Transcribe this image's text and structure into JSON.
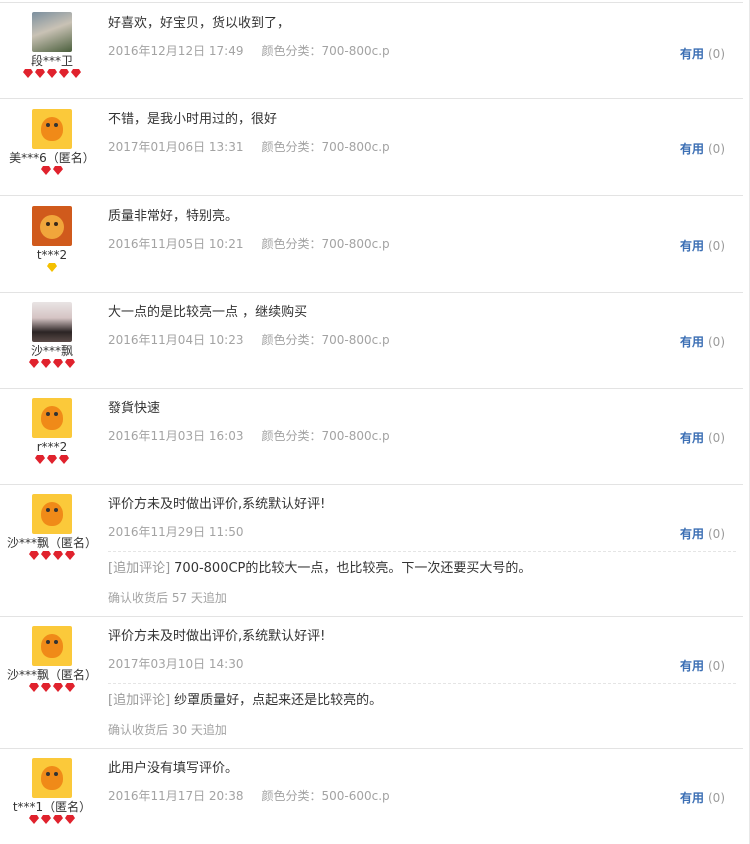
{
  "useful_label": "有用",
  "reviews": [
    {
      "avatar": "photo-avatar-plant",
      "username": "段***卫",
      "rank": {
        "color": "red",
        "count": 5
      },
      "content": "好喜欢，好宝贝，货以收到了，",
      "date": "2016年12月12日 17:49",
      "sku": "颜色分类：700-800c.p",
      "useful_count": "(0)"
    },
    {
      "avatar": "default-orange-avatar",
      "username": "美***6（匿名）",
      "rank": {
        "color": "red",
        "count": 2
      },
      "content": "不错，是我小时用过的，很好",
      "date": "2017年01月06日 13:31",
      "sku": "颜色分类：700-800c.p",
      "useful_count": "(0)"
    },
    {
      "avatar": "bear-avatar",
      "username": "t***2",
      "rank": {
        "color": "yellow",
        "count": 1
      },
      "content": "质量非常好，特别亮。",
      "date": "2016年11月05日 10:21",
      "sku": "颜色分类：700-800c.p",
      "useful_count": "(0)"
    },
    {
      "avatar": "photo-avatar-girl",
      "username": "沙***飘",
      "rank": {
        "color": "red",
        "count": 4
      },
      "content": "大一点的是比较亮一点 ，继续购买",
      "date": "2016年11月04日 10:23",
      "sku": "颜色分类：700-800c.p",
      "useful_count": "(0)"
    },
    {
      "avatar": "default-orange-avatar",
      "username": "r***2",
      "rank": {
        "color": "red",
        "count": 3
      },
      "content": "發貨快速",
      "date": "2016年11月03日 16:03",
      "sku": "颜色分类：700-800c.p",
      "useful_count": "(0)"
    },
    {
      "avatar": "default-orange-avatar",
      "username": "沙***飘（匿名）",
      "rank": {
        "color": "red",
        "count": 4
      },
      "content": "评价方未及时做出评价,系统默认好评!",
      "date": "2016年11月29日 11:50",
      "useful_count": "(0)",
      "append_tag": "[追加评论]",
      "append_text": "700-800CP的比较大一点，也比较亮。下一次还要买大号的。",
      "append_meta": "确认收货后 57 天追加"
    },
    {
      "avatar": "default-orange-avatar",
      "username": "沙***飘（匿名）",
      "rank": {
        "color": "red",
        "count": 4
      },
      "content": "评价方未及时做出评价,系统默认好评!",
      "date": "2017年03月10日 14:30",
      "useful_count": "(0)",
      "append_tag": "[追加评论]",
      "append_text": "纱罩质量好，点起来还是比较亮的。",
      "append_meta": "确认收货后 30 天追加"
    },
    {
      "avatar": "default-orange-avatar",
      "username": "t***1（匿名）",
      "rank": {
        "color": "red",
        "count": 4
      },
      "content": "此用户没有填写评价。",
      "date": "2016年11月17日 20:38",
      "sku": "颜色分类：500-600c.p",
      "useful_count": "(0)"
    }
  ]
}
